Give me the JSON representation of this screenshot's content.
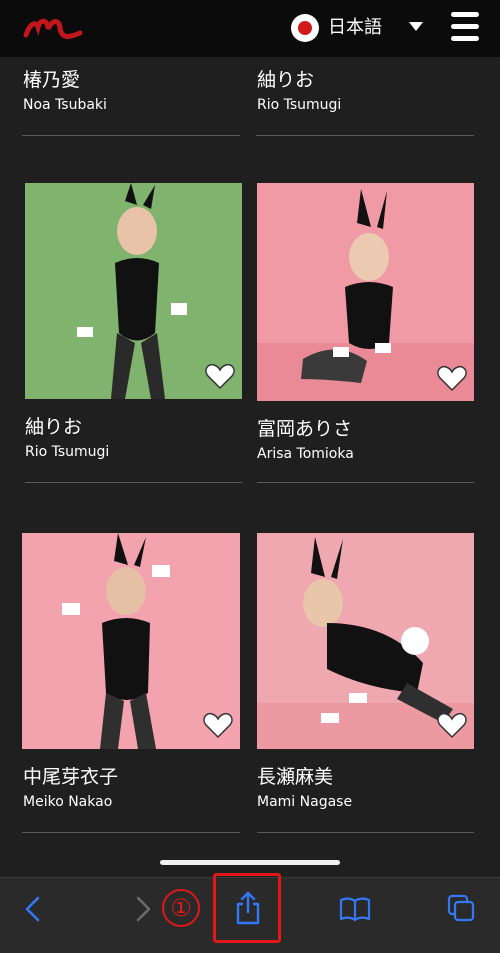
{
  "header": {
    "language_label": "日本語",
    "brand_color": "#c2161c"
  },
  "partial_row": [
    {
      "name_jp": "椿乃愛",
      "name_en": "Noa Tsubaki"
    },
    {
      "name_jp": "紬りお",
      "name_en": "Rio Tsumugi"
    }
  ],
  "cards": [
    {
      "name_jp": "紬りお",
      "name_en": "Rio Tsumugi",
      "background": "#7fb36e"
    },
    {
      "name_jp": "富岡ありさ",
      "name_en": "Arisa Tomioka",
      "background": "#ef9aa4"
    },
    {
      "name_jp": "中尾芽衣子",
      "name_en": "Meiko Nakao",
      "background": "#f2a3ad"
    },
    {
      "name_jp": "長瀬麻美",
      "name_en": "Mami Nagase",
      "background": "#f0a8b0"
    }
  ],
  "annotation": {
    "step_marker": "①",
    "marker_color": "#e01818"
  },
  "toolbar": {
    "icons": [
      "back-icon",
      "forward-icon",
      "share-icon",
      "bookmarks-icon",
      "tabs-icon"
    ],
    "accent_color": "#3478f6"
  }
}
